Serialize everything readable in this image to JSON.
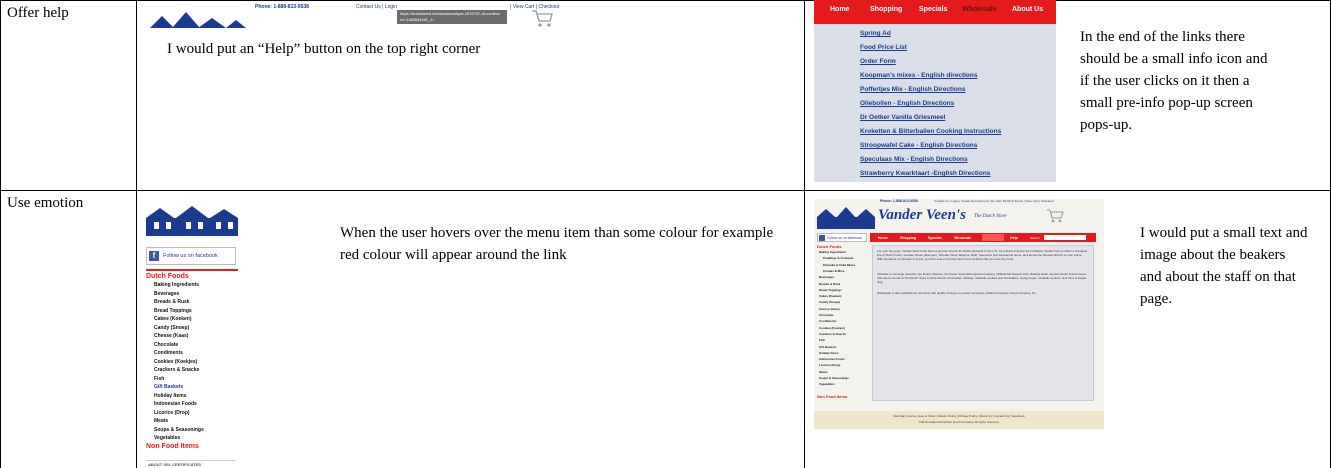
{
  "rows": [
    {
      "label": "Offer help",
      "note_middle": "I would put an “Help” button on the top right corner",
      "note_right": "In the end of the links there should be a small info icon and if the user clicks on it then a small pre-info pop-up screen pops-up."
    },
    {
      "label": "Use emotion",
      "note_middle": "When the user hovers over the menu item than some colour for example red colour will appear around the link",
      "note_right": "I would put a small text and image about the beakers and about the staff on that page."
    }
  ],
  "shot_header": {
    "phone": "Phone: 1-888-813-9538",
    "links": "Contact Us | Login",
    "tooltip": "https://dutchswed.info/download/pid-2876767-dt-content-rid-3168504481_1/",
    "view_cart": "| View Cart | Checkout"
  },
  "shot_menu": {
    "tabs": [
      "Home",
      "Shopping",
      "Specials",
      "Wholesale",
      "About Us"
    ],
    "links": [
      "Spring Ad",
      "Food Price List",
      "Order Form",
      "Koopman's mixes - English directions",
      "Poffertjes Mix - English Directions",
      "Oliebollen - English Directions",
      "Dr Oetker Vanilla Griesmeel",
      "Kroketten & Bitterballen Cooking Instructions",
      "Stroopwafel Cake - English Directions",
      "Speculaas Mix - English Directions",
      "Strawberry Kwarktaart -English Directions"
    ]
  },
  "shot_sidebar": {
    "facebook": "Follow us on facebook",
    "heading": "Dutch Foods",
    "items": [
      "Baking Ingredients",
      "Beverages",
      "Breads & Rusk",
      "Bread Toppings",
      "Cakes (Koeken)",
      "Candy (Snoep)",
      "Cheese (Kaas)",
      "Chocolate",
      "Condiments",
      "Cookies (Koekjes)",
      "Crackers & Snacks",
      "Fish",
      "Gift Baskets",
      "Holiday Items",
      "Indonesian Foods",
      "Licorice (Drop)",
      "Meats",
      "Soups & Seasonings",
      "Vegetables"
    ],
    "non_food": "Non Food Items",
    "footer": "ABOUT SSL CERTIFICATES"
  },
  "shot_site": {
    "phone": "Phone: 1-888-813-9538",
    "top_links": "Contact Us | Login | Create New Account | My Cart: $0.00 (0 items) | View Cart | Checkout",
    "brand": "Vander Veen's",
    "brand_tag": "The Dutch Store",
    "facebook": "Follow us on facebook",
    "tabs": [
      "Home",
      "Shopping",
      "Specials",
      "Wholesale",
      "Help"
    ],
    "search_label": "Search",
    "side_heading": "Dutch Foods",
    "side_items": [
      "Baking Ingredients",
      "Puddings & Custards",
      "Pancake & Cake Mixes",
      "Cereals & Misc.",
      "Beverages",
      "Breads & Rusk",
      "Bread Toppings",
      "Cakes (Koeken)",
      "Candy (Snoep)",
      "Cheese (Kaas)",
      "Chocolate",
      "Condiments",
      "Cookies (Koekjes)",
      "Crackers & Snacks",
      "Fish",
      "Gift Baskets",
      "Holiday Items",
      "Indonesian Foods",
      "Licorice (Drop)",
      "Meats",
      "Soups & Seasonings",
      "Vegetables"
    ],
    "side_non_food": "Non Food Items",
    "body_para1": "For over 60 years, Vander Veen's has been a premier source for Dutch products in the U.S. As a direct importer from Holland, Vander Veen's offers a complete line of Dutch foods, wooden shoes (klompen), Wooden Shoe Slippers, Delft, Souvenirs and Household items, and all can be shipped directly to your home. With hundreds of varieties of foods, you'll be sure to find the items from Holland that you miss the most.",
    "body_para2": "Included in our large selection are Dutch cheeses, de Ruyter Speculaas (spiced cookies), Wilhelmina Peppermints, Bolletje Rusk, famous Dutch brand names that can be found at The Dutch Store include Droste Chocolates, Bolletje, Verkade cookies and chocolates, Honig soups, Verkade cookies, and Venz & Hagel-slag.",
    "body_para3": "Wholesale is also available for accounts that qualify through our parent company, Holland American Food Company, Inc.",
    "footer_links": "Site Map | Home | How to Order | Return Policy | Privacy Policy | About Us | Contact Us | Facebook",
    "footer_copy": "©2013 Holland American Food Company. All rights reserved."
  }
}
